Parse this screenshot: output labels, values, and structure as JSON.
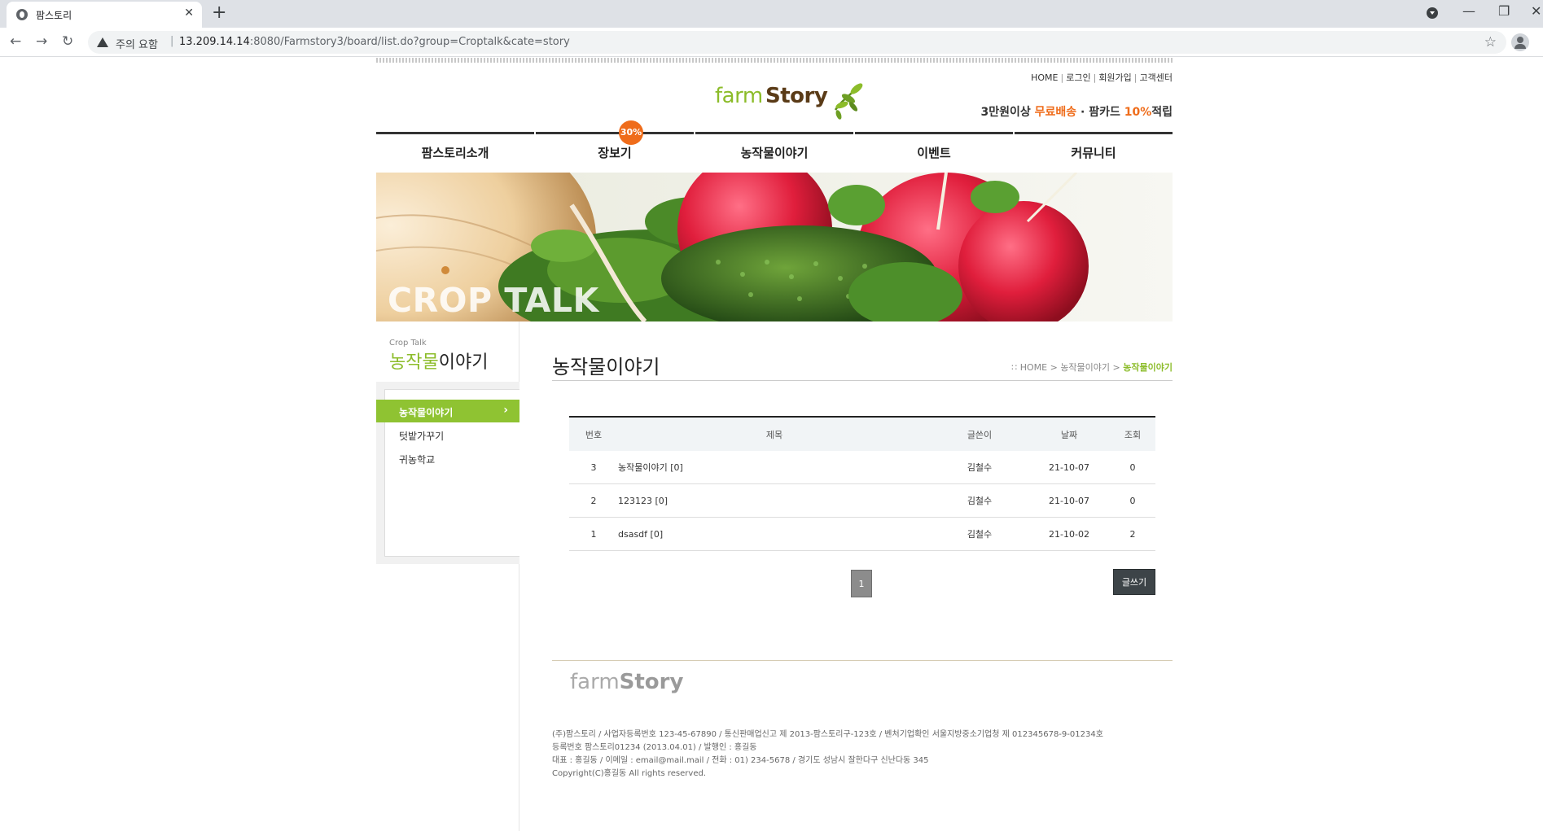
{
  "browser": {
    "tab_title": "팜스토리",
    "warning": "주의 요함",
    "url_host": "13.209.14.14",
    "url_rest": ":8080/Farmstory3/board/list.do?group=Croptalk&cate=story"
  },
  "header": {
    "util_links": [
      "HOME",
      "로그인",
      "회원가입",
      "고객센터"
    ],
    "promo_prefix": "3만원이상 ",
    "promo_free": "무료배송",
    "promo_mid": " · 팜카드 ",
    "promo_percent": "10%",
    "promo_suffix": "적립",
    "logo_farm": "farm",
    "logo_story": "Story"
  },
  "gnb": {
    "items": [
      "팜스토리소개",
      "장보기",
      "농작물이야기",
      "이벤트",
      "커뮤니티"
    ],
    "badge": "30%"
  },
  "banner": {
    "title": "CROP TALK"
  },
  "sidebar": {
    "sub": "Crop Talk",
    "title_green": "농작물",
    "title_rest": "이야기",
    "items": [
      "농작물이야기",
      "텃밭가꾸기",
      "귀농학교"
    ]
  },
  "main": {
    "title": "농작물이야기",
    "breadcrumb_home": "HOME",
    "breadcrumb_mid": "농작물이야기",
    "breadcrumb_current": "농작물이야기"
  },
  "board": {
    "columns": [
      "번호",
      "제목",
      "글쓴이",
      "날짜",
      "조회"
    ],
    "rows": [
      {
        "no": "3",
        "title": "농작물이야기 [0]",
        "writer": "김철수",
        "date": "21-10-07",
        "hit": "0"
      },
      {
        "no": "2",
        "title": "123123 [0]",
        "writer": "김철수",
        "date": "21-10-07",
        "hit": "0"
      },
      {
        "no": "1",
        "title": "dsasdf [0]",
        "writer": "김철수",
        "date": "21-10-02",
        "hit": "2"
      }
    ],
    "page": "1",
    "write_label": "글쓰기"
  },
  "footer": {
    "logo_farm": "farm",
    "logo_story": "Story",
    "lines": [
      "(주)팜스토리 / 사업자등록번호 123-45-67890 / 통신판매업신고 제 2013-팜스토리구-123호 / 벤처기업확인 서울지방중소기업청 제 012345678-9-01234호",
      "등록번호 팜스토리01234 (2013.04.01) / 발행인 : 홍길동",
      "대표 : 홍길동 / 이메일 : email@mail.mail / 전화 : 01) 234-5678 / 경기도 성남시 잘한다구 신난다동 345",
      "Copyright(C)홍길동 All rights reserved."
    ]
  },
  "colors": {
    "brand_green": "#8cbc2a",
    "accent_orange": "#ef6c1a",
    "active_menu": "#8fc332"
  }
}
